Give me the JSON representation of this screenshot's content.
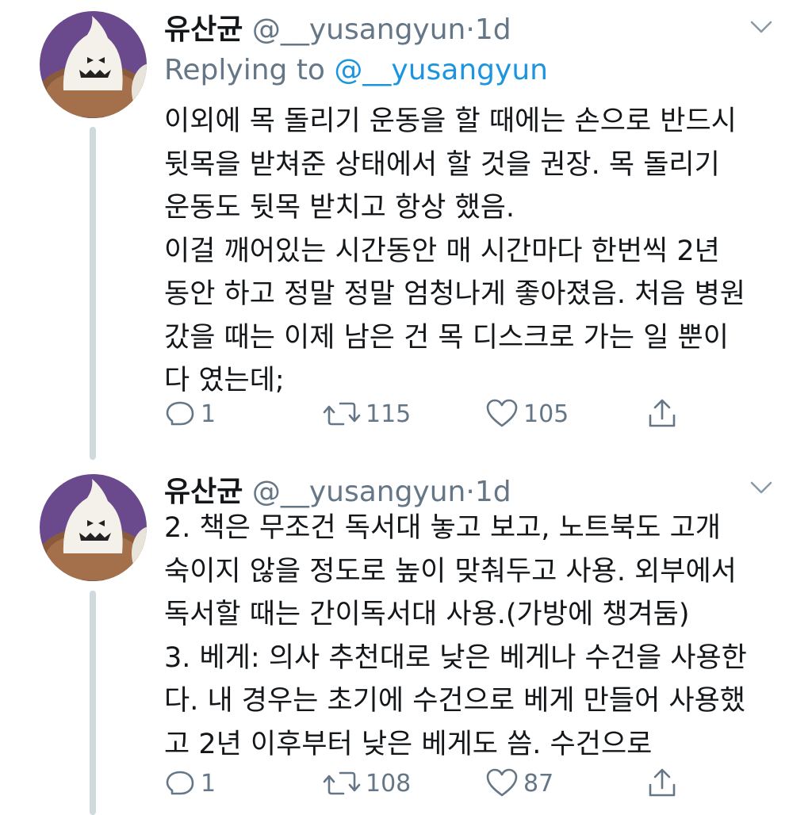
{
  "tweets": [
    {
      "author_name": "유산균",
      "handle": "@__yusangyun",
      "separator": "·",
      "time": "1d",
      "replying_to_label": "Replying to",
      "replying_to_handle": "@__yusangyun",
      "lines": [
        "이외에 목 돌리기 운동을 할 때에는 손으로 반드시",
        "뒷목을 받쳐준 상태에서 할 것을 권장. 목 돌리기",
        "운동도 뒷목 받치고 항상 했음.",
        "이걸 깨어있는 시간동안 매 시간마다 한번씩 2년",
        "동안 하고 정말 정말 엄청나게 좋아졌음. 처음 병원",
        "갔을 때는 이제 남은 건 목 디스크로 가는 일 뿐이",
        "다 였는데;"
      ],
      "reply_count": "1",
      "retweet_count": "115",
      "like_count": "105",
      "icons": [
        "reply-icon",
        "retweet-icon",
        "like-icon",
        "share-icon",
        "chevron-down-icon"
      ]
    },
    {
      "author_name": "유산균",
      "handle": "@__yusangyun",
      "separator": "·",
      "time": "1d",
      "lines": [
        "2. 책은 무조건 독서대 놓고 보고, 노트북도 고개",
        "숙이지 않을 정도로 높이 맞춰두고 사용. 외부에서",
        "독서할 때는 간이독서대 사용.(가방에 챙겨둠)",
        "3. 베게: 의사 추천대로 낮은 베게나 수건을 사용한",
        "다. 내 경우는 초기에 수건으로 베게 만들어 사용했",
        "고 2년 이후부터 낮은 베게도 씀. 수건으로"
      ],
      "reply_count": "1",
      "retweet_count": "108",
      "like_count": "87",
      "icons": [
        "reply-icon",
        "retweet-icon",
        "like-icon",
        "share-icon",
        "chevron-down-icon"
      ]
    }
  ],
  "colors": {
    "text": "#14171a",
    "secondary": "#657786",
    "link": "#1b95e0",
    "thread_line": "#cfd9de",
    "avatar_bg": "#6a4a8c"
  }
}
